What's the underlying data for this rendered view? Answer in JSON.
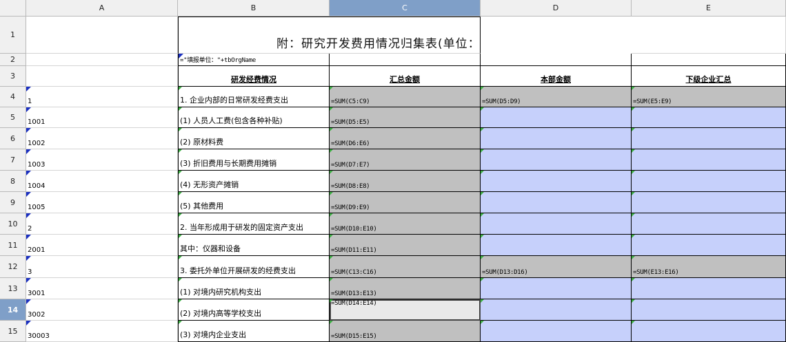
{
  "columns": [
    "A",
    "B",
    "C",
    "D",
    "E"
  ],
  "selected_column": "C",
  "selected_row": "14",
  "title": "附：研究开发费用情况归集表(单位：千元)",
  "row2_formula": "=\"填报单位：\"+tbOrgName",
  "headers": {
    "b": "研发经费情况",
    "c": "汇总金额",
    "d": "本部金额",
    "e": "下级企业汇总"
  },
  "rows": [
    {
      "num": "4",
      "code": "1",
      "item": "1. 企业内部的日常研发经费支出",
      "c": "=SUM(C5:C9)",
      "d": "=SUM(D5:D9)",
      "e": "=SUM(E5:E9)"
    },
    {
      "num": "5",
      "code": "1001",
      "item": "(1) 人员人工费(包含各种补贴)",
      "c": "=SUM(D5:E5)",
      "d": "",
      "e": ""
    },
    {
      "num": "6",
      "code": "1002",
      "item": "(2) 原材料费",
      "c": "=SUM(D6:E6)",
      "d": "",
      "e": ""
    },
    {
      "num": "7",
      "code": "1003",
      "item": "(3) 折旧费用与长期费用摊销",
      "c": "=SUM(D7:E7)",
      "d": "",
      "e": ""
    },
    {
      "num": "8",
      "code": "1004",
      "item": "(4) 无形资产摊销",
      "c": "=SUM(D8:E8)",
      "d": "",
      "e": ""
    },
    {
      "num": "9",
      "code": "1005",
      "item": "(5) 其他费用",
      "c": "=SUM(D9:E9)",
      "d": "",
      "e": ""
    },
    {
      "num": "10",
      "code": "2",
      "item": "2. 当年形成用于研发的固定资产支出",
      "c": "=SUM(D10:E10)",
      "d": "",
      "e": ""
    },
    {
      "num": "11",
      "code": "2001",
      "item": "   其中：仪器和设备",
      "c": "=SUM(D11:E11)",
      "d": "",
      "e": ""
    },
    {
      "num": "12",
      "code": "3",
      "item": "3. 委托外单位开展研发的经费支出",
      "c": "=SUM(C13:C16)",
      "d": "=SUM(D13:D16)",
      "e": "=SUM(E13:E16)"
    },
    {
      "num": "13",
      "code": "3001",
      "item": "(1) 对境内研究机构支出",
      "c": "=SUM(D13:E13)",
      "d": "",
      "e": ""
    },
    {
      "num": "14",
      "code": "3002",
      "item": "(2) 对境内高等学校支出",
      "c": "=SUM(D14:E14)",
      "d": "",
      "e": ""
    },
    {
      "num": "15",
      "code": "30003",
      "item": "(3) 对境内企业支出",
      "c": "=SUM(D15:E15)",
      "d": "",
      "e": ""
    }
  ],
  "row_labels_top": [
    "1",
    "2",
    "3"
  ]
}
